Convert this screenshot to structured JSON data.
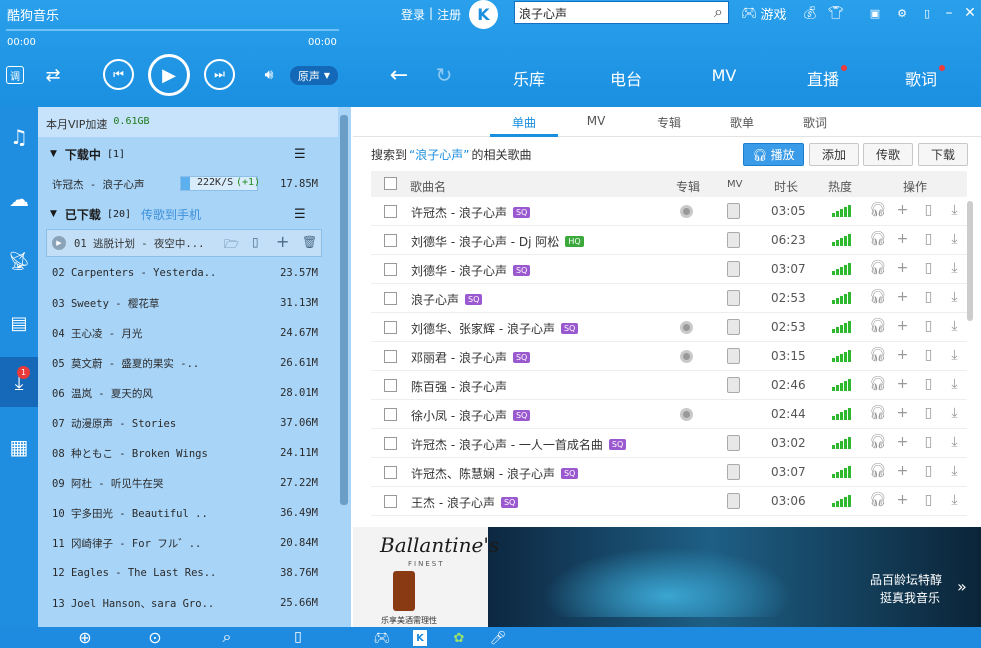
{
  "app": {
    "title": "酷狗音乐"
  },
  "header": {
    "login": "登录",
    "sep": "|",
    "register": "注册",
    "search_value": "浪子心声",
    "games": "游戏",
    "time_left": "00:00",
    "time_right": "00:00",
    "sound_mode": "原声"
  },
  "nav": {
    "tabs": [
      "乐库",
      "电台",
      "MV",
      "直播",
      "歌词"
    ]
  },
  "panel": {
    "vip_label": "本月VIP加速",
    "vip_value": "0.61GB",
    "downloading_label": "下载中",
    "downloading_count": "[1]",
    "dl_item": {
      "name": "许冠杰 - 浪子心声",
      "speed": "222K/S",
      "delta": "(+1)",
      "size": "17.85M"
    },
    "downloaded_label": "已下载",
    "downloaded_count": "[20]",
    "send_to_phone": "传歌到手机",
    "first_item": "01 逃脱计划 - 夜空中...",
    "items": [
      {
        "name": "02 Carpenters - Yesterda..",
        "size": "23.57M"
      },
      {
        "name": "03 Sweety - 樱花草",
        "size": "31.13M"
      },
      {
        "name": "04 王心凌 - 月光",
        "size": "24.67M"
      },
      {
        "name": "05 莫文蔚 - 盛夏的果实 -..",
        "size": "26.61M"
      },
      {
        "name": "06 温岚 - 夏天的风",
        "size": "28.01M"
      },
      {
        "name": "07 动漫原声 - Stories",
        "size": "37.06M"
      },
      {
        "name": "08 种ともこ - Broken Wings",
        "size": "24.11M"
      },
      {
        "name": "09 阿杜 - 听见牛在哭",
        "size": "27.22M"
      },
      {
        "name": "10 宇多田光 - Beautiful ..",
        "size": "36.49M"
      },
      {
        "name": "11 冈崎律子 - For フル゛..",
        "size": "20.84M"
      },
      {
        "name": "12 Eagles - The Last Res..",
        "size": "38.76M"
      },
      {
        "name": "13 Joel Hanson、sara Gro..",
        "size": "25.66M"
      }
    ],
    "download_badge": "1"
  },
  "main": {
    "subtabs": [
      "单曲",
      "MV",
      "专辑",
      "歌单",
      "歌词"
    ],
    "result_prefix": "搜索到",
    "result_query": "“浪子心声”",
    "result_suffix": "的相关歌曲",
    "buttons": {
      "play": "播放",
      "add": "添加",
      "send": "传歌",
      "download": "下载"
    },
    "columns": {
      "name": "歌曲名",
      "album": "专辑",
      "mv": "MV",
      "duration": "时长",
      "hot": "热度",
      "ops": "操作"
    },
    "songs": [
      {
        "name": "许冠杰 - 浪子心声",
        "tag": "SQ",
        "album": true,
        "mv": true,
        "duration": "03:05"
      },
      {
        "name": "刘德华 - 浪子心声 - Dj 阿松",
        "tag": "HQ",
        "album": false,
        "mv": true,
        "duration": "06:23"
      },
      {
        "name": "刘德华 - 浪子心声",
        "tag": "SQ",
        "album": false,
        "mv": true,
        "duration": "03:07"
      },
      {
        "name": "浪子心声",
        "tag": "SQ",
        "album": false,
        "mv": true,
        "duration": "02:53"
      },
      {
        "name": "刘德华、张家辉 - 浪子心声",
        "tag": "SQ",
        "album": true,
        "mv": true,
        "duration": "02:53"
      },
      {
        "name": "邓丽君 - 浪子心声",
        "tag": "SQ",
        "album": true,
        "mv": true,
        "duration": "03:15"
      },
      {
        "name": "陈百强 - 浪子心声",
        "tag": "",
        "album": false,
        "mv": true,
        "duration": "02:46"
      },
      {
        "name": "徐小凤 - 浪子心声",
        "tag": "SQ",
        "album": true,
        "mv": false,
        "duration": "02:44"
      },
      {
        "name": "许冠杰 - 浪子心声 - 一人一首成名曲",
        "tag": "SQ",
        "album": false,
        "mv": true,
        "duration": "03:02"
      },
      {
        "name": "许冠杰、陈慧娴 - 浪子心声",
        "tag": "SQ",
        "album": false,
        "mv": true,
        "duration": "03:07"
      },
      {
        "name": "王杰 - 浪子心声",
        "tag": "SQ",
        "album": false,
        "mv": true,
        "duration": "03:06"
      }
    ]
  },
  "ad": {
    "brand": "Ballantine's",
    "sub": "FINEST",
    "line1": "品百龄坛特醇",
    "line2": "挺真我音乐",
    "small": "乐享美酒需理性"
  },
  "colors": {
    "accent": "#1b8fe0",
    "panel": "#a8d4f8",
    "hot": "#2eb82e",
    "sq_tag": "#9b59d0"
  }
}
